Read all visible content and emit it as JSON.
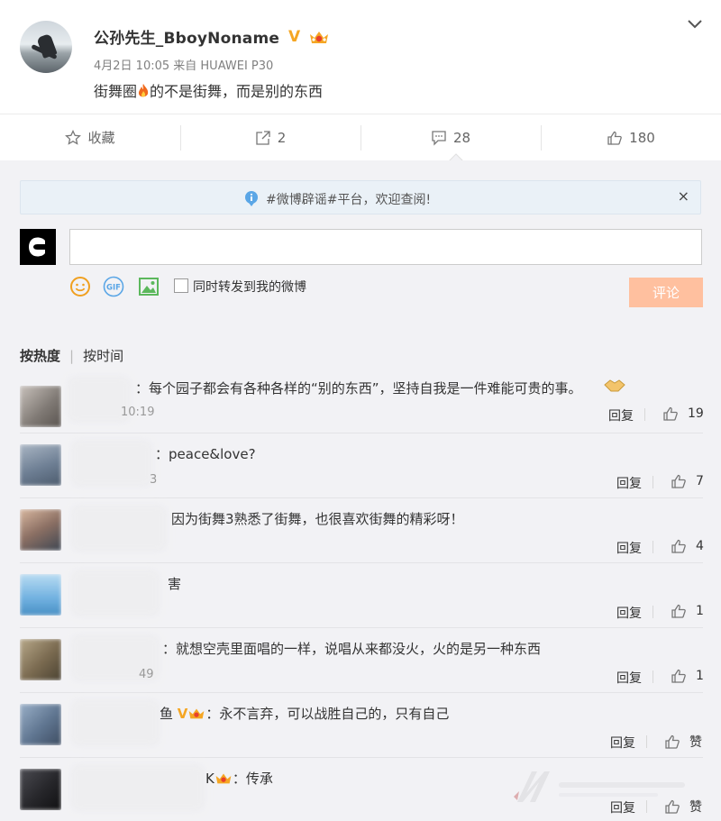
{
  "post": {
    "author": "公孙先生_BboyNoname",
    "verified_mark": "V",
    "meta": "4月2日 10:05 来自 HUAWEI P30",
    "text_before": "街舞圈",
    "text_after": "的不是街舞，而是别的东西"
  },
  "actions": [
    {
      "icon": "star-icon",
      "label": "收藏"
    },
    {
      "icon": "repost-icon",
      "label": "2"
    },
    {
      "icon": "comment-icon",
      "label": "28"
    },
    {
      "icon": "like-icon",
      "label": "180"
    }
  ],
  "notice": {
    "text": "#微博辟谣#平台，欢迎查阅!",
    "close": "×"
  },
  "compose": {
    "input_value": "",
    "forward_label": "同时转发到我的微博",
    "submit_label": "评论"
  },
  "sort": {
    "hot": "按热度",
    "separator": "|",
    "time": "按时间"
  },
  "comments": [
    {
      "text": "：每个园子都会有各种各样的“别的东西”，坚持自我是一件难能可贵的事。",
      "time": "10:19",
      "reply": "回复",
      "likes": "19"
    },
    {
      "text": "：peace&love?",
      "time": "3",
      "reply": "回复",
      "likes": "7"
    },
    {
      "text": "因为街舞3熟悉了街舞，也很喜欢街舞的精彩呀！",
      "time": "",
      "reply": "回复",
      "likes": "4"
    },
    {
      "text": "害",
      "time": "",
      "reply": "回复",
      "likes": "1"
    },
    {
      "text": "：就想空壳里面唱的一样，说唱从来都没火，火的是另一种东西",
      "time": "49",
      "reply": "回复",
      "likes": "1"
    },
    {
      "text": "：永不言弃，可以战胜自己的，只有自己",
      "name_tail": "鱼",
      "verified_mark": "V",
      "time": "",
      "reply": "回复",
      "likes": "赞"
    },
    {
      "text": "：传承",
      "name_tail": "K",
      "time": "",
      "reply": "回复",
      "likes": "赞"
    }
  ],
  "colors": {
    "accent_orange": "#f5a623",
    "submit_disabled": "#ffc09f",
    "notice_bg": "#eaf1f7",
    "panel_bg": "#f2f2f5"
  }
}
